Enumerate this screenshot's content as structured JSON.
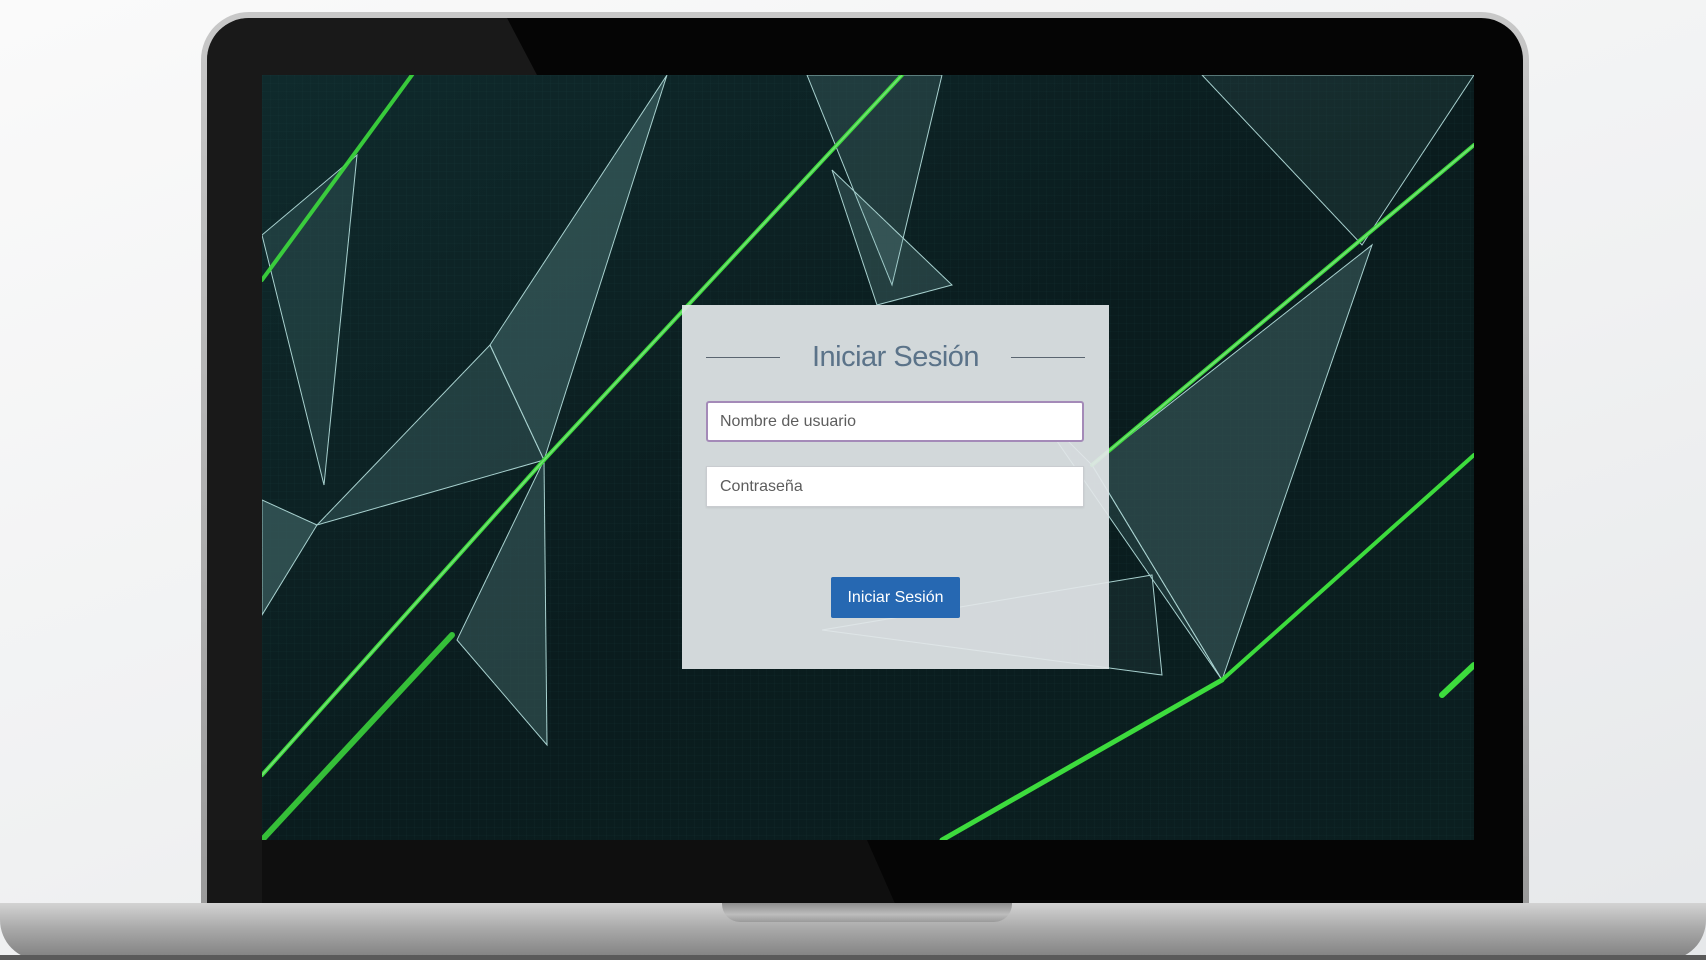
{
  "login": {
    "title": "Iniciar Sesión",
    "username_placeholder": "Nombre de usuario",
    "password_placeholder": "Contraseña",
    "submit_label": "Iniciar Sesión"
  },
  "theme": {
    "background_color": "#0b1d1f",
    "accent_line_color": "#3ddc3d",
    "button_color": "#2668b2",
    "title_color": "#5b7389"
  }
}
